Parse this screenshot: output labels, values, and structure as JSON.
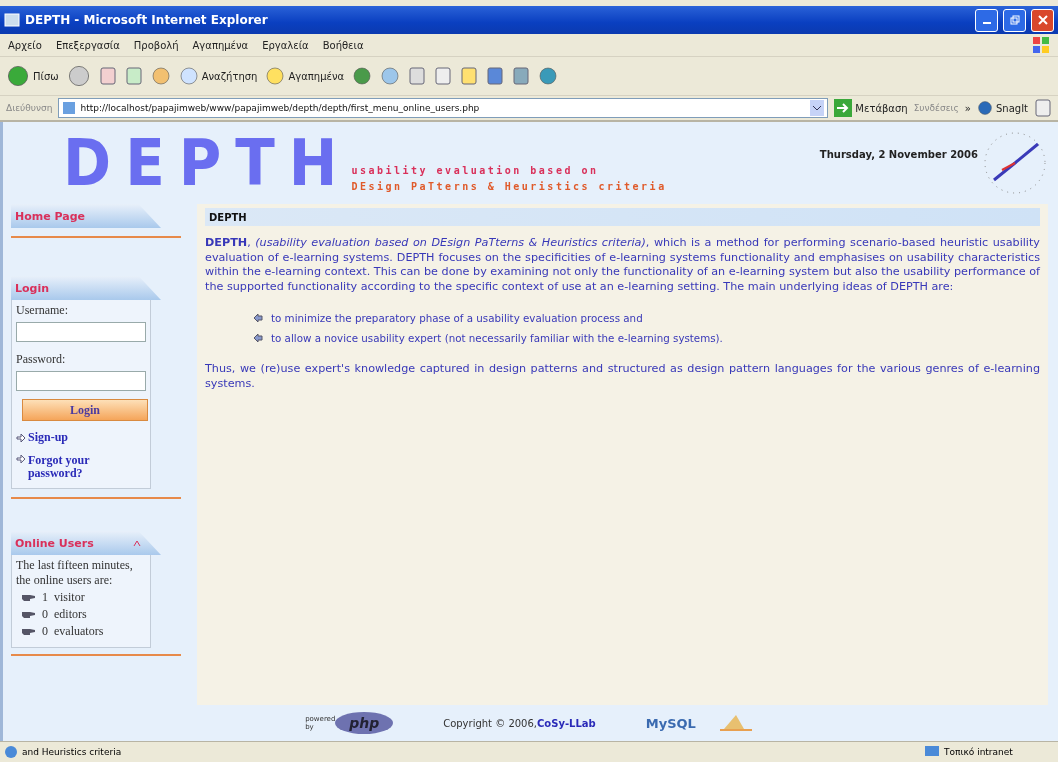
{
  "window": {
    "title": "DEPTH - Microsoft Internet Explorer"
  },
  "menu": [
    "Αρχείο",
    "Επεξεργασία",
    "Προβολή",
    "Αγαπημένα",
    "Εργαλεία",
    "Βοήθεια"
  ],
  "toolbar": {
    "back": "Πίσω",
    "search": "Αναζήτηση",
    "favorites": "Αγαπημένα"
  },
  "address": {
    "label": "Διεύθυνση",
    "url": "http://localhost/papajimweb/www/papajimweb/depth/depth/first_menu_online_users.php",
    "go": "Μετάβαση",
    "links": "Συνδέσεις",
    "more": "»",
    "snagit": "SnagIt"
  },
  "header": {
    "logo": "DEPTH",
    "tagline": [
      "usability evaluation based on",
      "DEsign PaTterns & Heuristics criteria"
    ],
    "date": "Thursday, 2 November 2006"
  },
  "sidebar": {
    "home": "Home Page",
    "login": {
      "title": "Login",
      "username_label": "Username:",
      "password_label": "Password:",
      "button": "Login",
      "links": [
        "Sign-up",
        "Forgot your password?"
      ]
    },
    "online": {
      "title": "Online Users",
      "intro": "The last fifteen minutes, the online users are:",
      "items": [
        {
          "count": "1",
          "label": "visitor"
        },
        {
          "count": "0",
          "label": "editors"
        },
        {
          "count": "0",
          "label": "evaluators"
        }
      ]
    }
  },
  "content": {
    "heading": "DEPTH",
    "intro": "**DEPTH**, *(usability evaluation based on DEsign PaTterns & Heuristics criteria)*, which is a method for performing scenario-based heuristic usability evaluation of e-learning systems. DEPTH focuses on the specificities of e-learning systems functionality and emphasises on usability characteristics within the e-learning context. This can be done by examining not only the functionality of an e-learning system but also the usability performance of the supported functionality according to the specific context of use at an e-learning setting. The main underlying ideas of DEPTH are:",
    "bullets": [
      "to minimize the preparatory phase of a usability evaluation process and",
      "to allow a novice usability expert (not necessarily familiar with the e-learning systems)."
    ],
    "closing": "Thus, we (re)use expert's knowledge captured in design patterns and structured as design pattern languages for the various genres of e-learning systems."
  },
  "footer": {
    "powered": "powered by",
    "php": "php",
    "copyright": "Copyright © 2006, ",
    "lab": "CoSy-LLab",
    "mysql": "MySQL"
  },
  "status": {
    "text": "and Heuristics criteria",
    "zone": "Τοπικό intranet"
  }
}
